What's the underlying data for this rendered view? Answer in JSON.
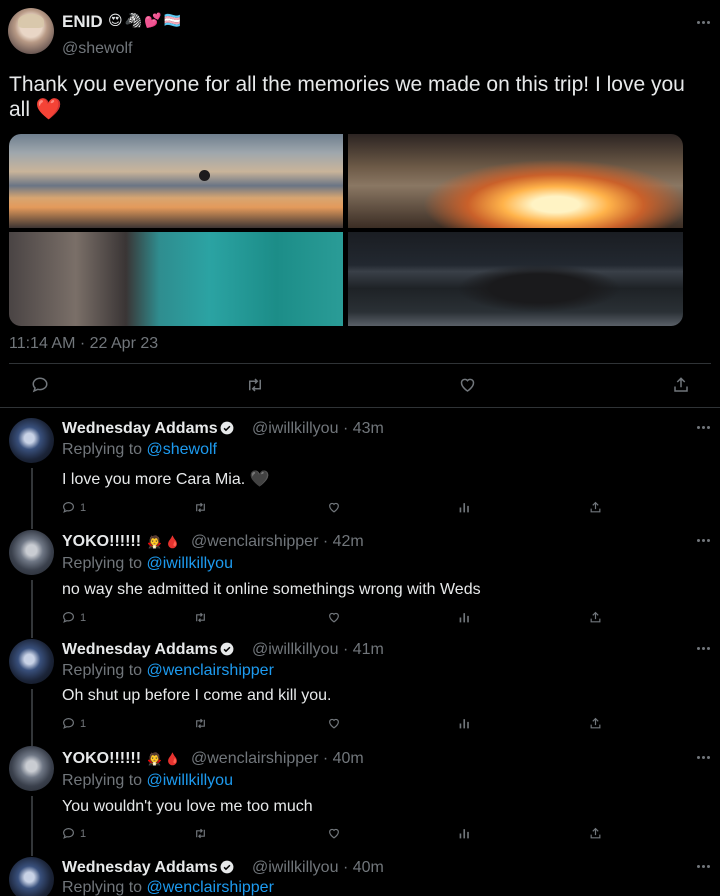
{
  "tweet": {
    "author_name": "ENID",
    "author_emoji": "😍🦓💕🏳️‍⚧️",
    "handle": "@shewolf",
    "text": "Thank you everyone for all the memories we made on this trip! I love you all ❤️",
    "timestamp": "11:14 AM · 22 Apr 23",
    "media_count": 4
  },
  "replies": [
    {
      "name": "Wednesday Addams",
      "verified": true,
      "emoji": "",
      "handle": "@iwillkillyou",
      "time": "· 43m",
      "replying_label": "Replying to",
      "replying_to": "@shewolf",
      "text": "I love you more Cara Mia. 🖤",
      "reply_count": "1"
    },
    {
      "name": "YOKO!!!!!!",
      "verified": false,
      "emoji": "🧛 🩸",
      "handle": "@wenclairshipper",
      "time": "· 42m",
      "replying_label": "Replying to",
      "replying_to": "@iwillkillyou",
      "text": "no way she admitted it online somethings wrong with Weds",
      "reply_count": "1"
    },
    {
      "name": "Wednesday Addams",
      "verified": true,
      "emoji": "",
      "handle": "@iwillkillyou",
      "time": "· 41m",
      "replying_label": "Replying to",
      "replying_to": "@wenclairshipper",
      "text": "Oh shut up before I come and kill you.",
      "reply_count": "1"
    },
    {
      "name": "YOKO!!!!!!",
      "verified": false,
      "emoji": "🧛 🩸",
      "handle": "@wenclairshipper",
      "time": "· 40m",
      "replying_label": "Replying to",
      "replying_to": "@iwillkillyou",
      "text": "You wouldn't you love me too much",
      "reply_count": "1"
    },
    {
      "name": "Wednesday Addams",
      "verified": true,
      "emoji": "",
      "handle": "@iwillkillyou",
      "time": "· 40m",
      "replying_label": "Replying to",
      "replying_to": "@wenclairshipper",
      "text": "",
      "reply_count": ""
    }
  ],
  "colors": {
    "background": "#000000",
    "text_primary": "#e7e9ea",
    "text_secondary": "#71767b",
    "link": "#1d9bf0",
    "divider": "#2f3336"
  },
  "icons": {
    "reply": "reply-icon",
    "retweet": "retweet-icon",
    "like": "like-icon",
    "share": "share-icon",
    "views": "views-icon",
    "more": "more-icon",
    "verified": "verified-badge-icon"
  }
}
